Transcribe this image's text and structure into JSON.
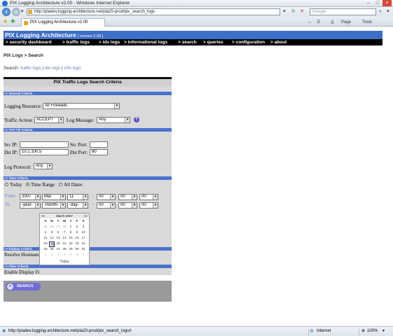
{
  "window": {
    "title": "PIX Logging Architecture v2.00 - Windows Internet Explorer",
    "controls": [
      "–",
      "□",
      "×"
    ]
  },
  "address_bar": {
    "url": "http://pladev.logging-architecture.net/pla20-prod/pix_search_logs",
    "search_placeholder": "Google",
    "back_icon": "back-arrow-icon",
    "forward_icon": "forward-arrow-icon"
  },
  "tab": {
    "label": "PIX Logging Architecture v2.00"
  },
  "command_bar": {
    "page": "Page",
    "tools": "Tools"
  },
  "app": {
    "title": "PIX Logging Architecture",
    "version": "[ version 2.00 ]",
    "menu": [
      "> security dashboard",
      "> traffic logs",
      "> ids logs",
      "> informational logs",
      "> search",
      "> queries",
      "> configuration",
      "> about"
    ]
  },
  "breadcrumb": "PIX Logs > Search",
  "search_links": {
    "prefix": "Search:",
    "traffic": "traffic logs",
    "ids": "ids logs",
    "info": "info logs",
    "sep": "|"
  },
  "panel": {
    "title": "PIX Traffic Logs Search Criteria",
    "sections": {
      "general": ">> General Criteria",
      "tcpip": ">> TCP / IP Criteria",
      "time": ">> Time Criteria",
      "display": ">> Display Criteria",
      "filter": ">> Filter Criteria"
    },
    "general": {
      "logging_resource_label": "Logging Resource:",
      "logging_resource_value": "All Firewalls",
      "traffic_action_label": "Traffic Action:",
      "traffic_action_value": "ACCEPT",
      "log_message_label": "Log Message:",
      "log_message_value": "Any",
      "help": "?"
    },
    "tcpip": {
      "src_ip_label": "Src IP:",
      "src_ip_value": "",
      "src_port_label": "Src Port:",
      "src_port_value": "",
      "dst_ip_label": "Dst IP:",
      "dst_ip_value": "10.1.100.5",
      "dst_port_label": "Dst Port:",
      "dst_port_value": "80",
      "log_protocol_label": "Log Protocol:",
      "log_protocol_value": "Any"
    },
    "time": {
      "today": "Today",
      "time_range": "Time Range",
      "all_dates": "All Dates",
      "selected": "time_range",
      "from_label": "From:",
      "to_label": "To:",
      "from": {
        "year": "2007",
        "month": "Mar",
        "day": "11",
        "h": "00",
        "m": "00",
        "s": "00"
      },
      "to": {
        "year": "-year-",
        "month": "-month-",
        "day": "-day-",
        "h": "00",
        "m": "00",
        "s": "00"
      },
      "dash": "-"
    },
    "display": {
      "resolve_label": "Resolve Hostnam"
    },
    "filter": {
      "enable_label": "Enable Display Fi"
    },
    "search_button": "SEARCH"
  },
  "calendar": {
    "month": "March 2007",
    "prev": "<<",
    "next": ">>",
    "weekdays": [
      "S",
      "M",
      "T",
      "W",
      "T",
      "F",
      "S"
    ],
    "weeks": [
      [
        "25",
        "26",
        "27",
        "28",
        "1",
        "2",
        "3"
      ],
      [
        "4",
        "5",
        "6",
        "7",
        "8",
        "9",
        "10"
      ],
      [
        "11",
        "12",
        "13",
        "14",
        "15",
        "16",
        "17"
      ],
      [
        "18",
        "19",
        "20",
        "21",
        "22",
        "23",
        "24"
      ],
      [
        "25",
        "26",
        "27",
        "28",
        "29",
        "30",
        "31"
      ],
      [
        "1",
        "2",
        "3",
        "4",
        "5",
        "6",
        "7"
      ]
    ],
    "selected_day": "19",
    "today_label": "Today"
  },
  "status_bar": {
    "url": "http://pladev.logging-architecture.net/pla20-prod/pix_search_logs#",
    "zone": "Internet",
    "zoom": "100%"
  }
}
